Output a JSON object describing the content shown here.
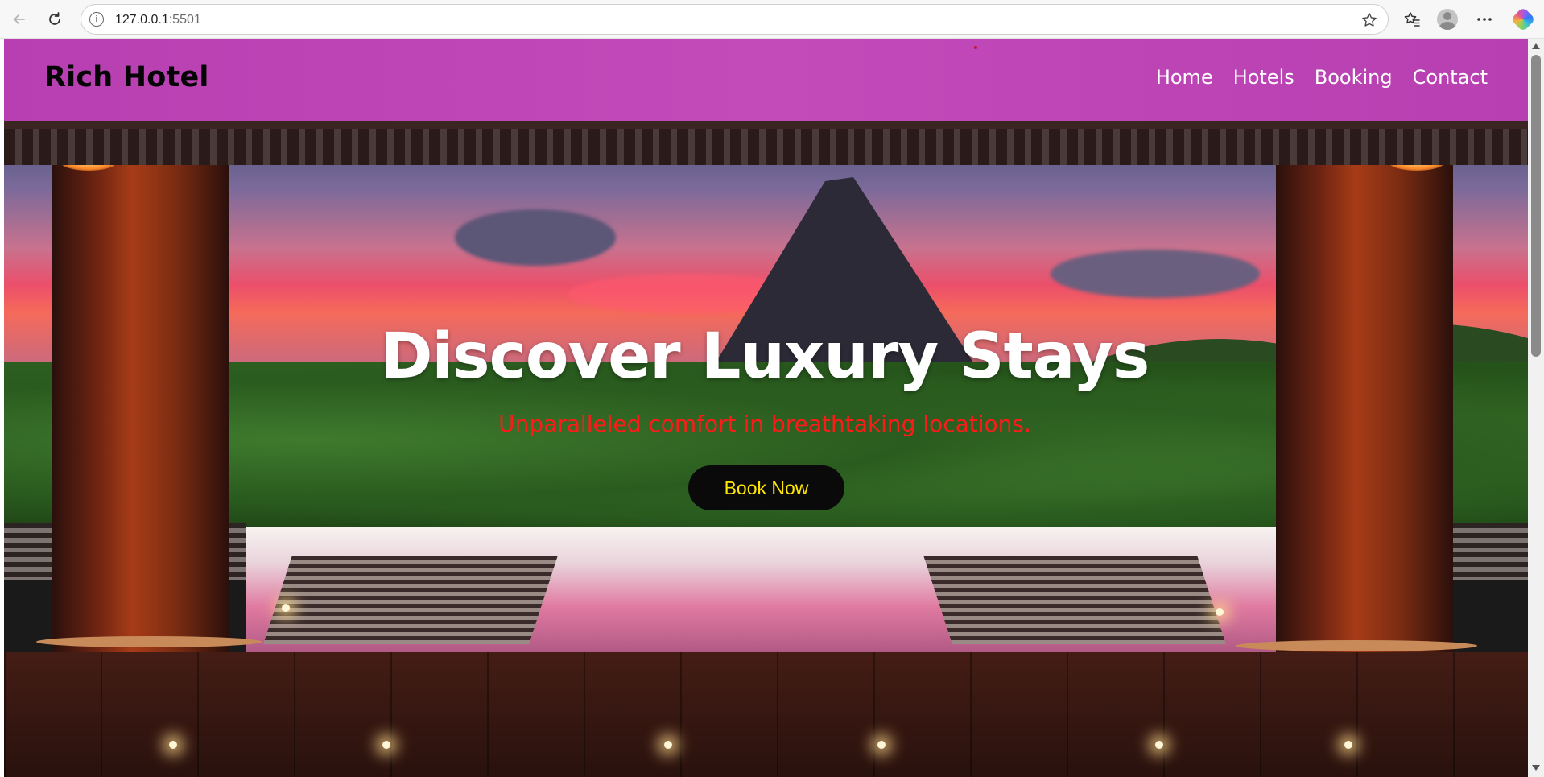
{
  "browser": {
    "url_host": "127.0.0.1",
    "url_port": ":5501",
    "info_icon": "i",
    "icons": [
      "back-arrow-icon",
      "reload-icon",
      "site-info-icon",
      "star-icon",
      "favorites-icon",
      "profile-icon",
      "more-icon",
      "copilot-icon"
    ]
  },
  "site": {
    "brand": "Rich Hotel",
    "nav": [
      {
        "label": "Home"
      },
      {
        "label": "Hotels"
      },
      {
        "label": "Booking"
      },
      {
        "label": "Contact"
      }
    ],
    "header_color": "#c247b9"
  },
  "hero": {
    "title": "Discover Luxury Stays",
    "subtitle": "Unparalleled comfort in breathtaking locations.",
    "cta_label": "Book Now",
    "subtitle_color": "#ff1a1a",
    "cta_bg": "#0a0a0a",
    "cta_text_color": "#ffe600"
  }
}
